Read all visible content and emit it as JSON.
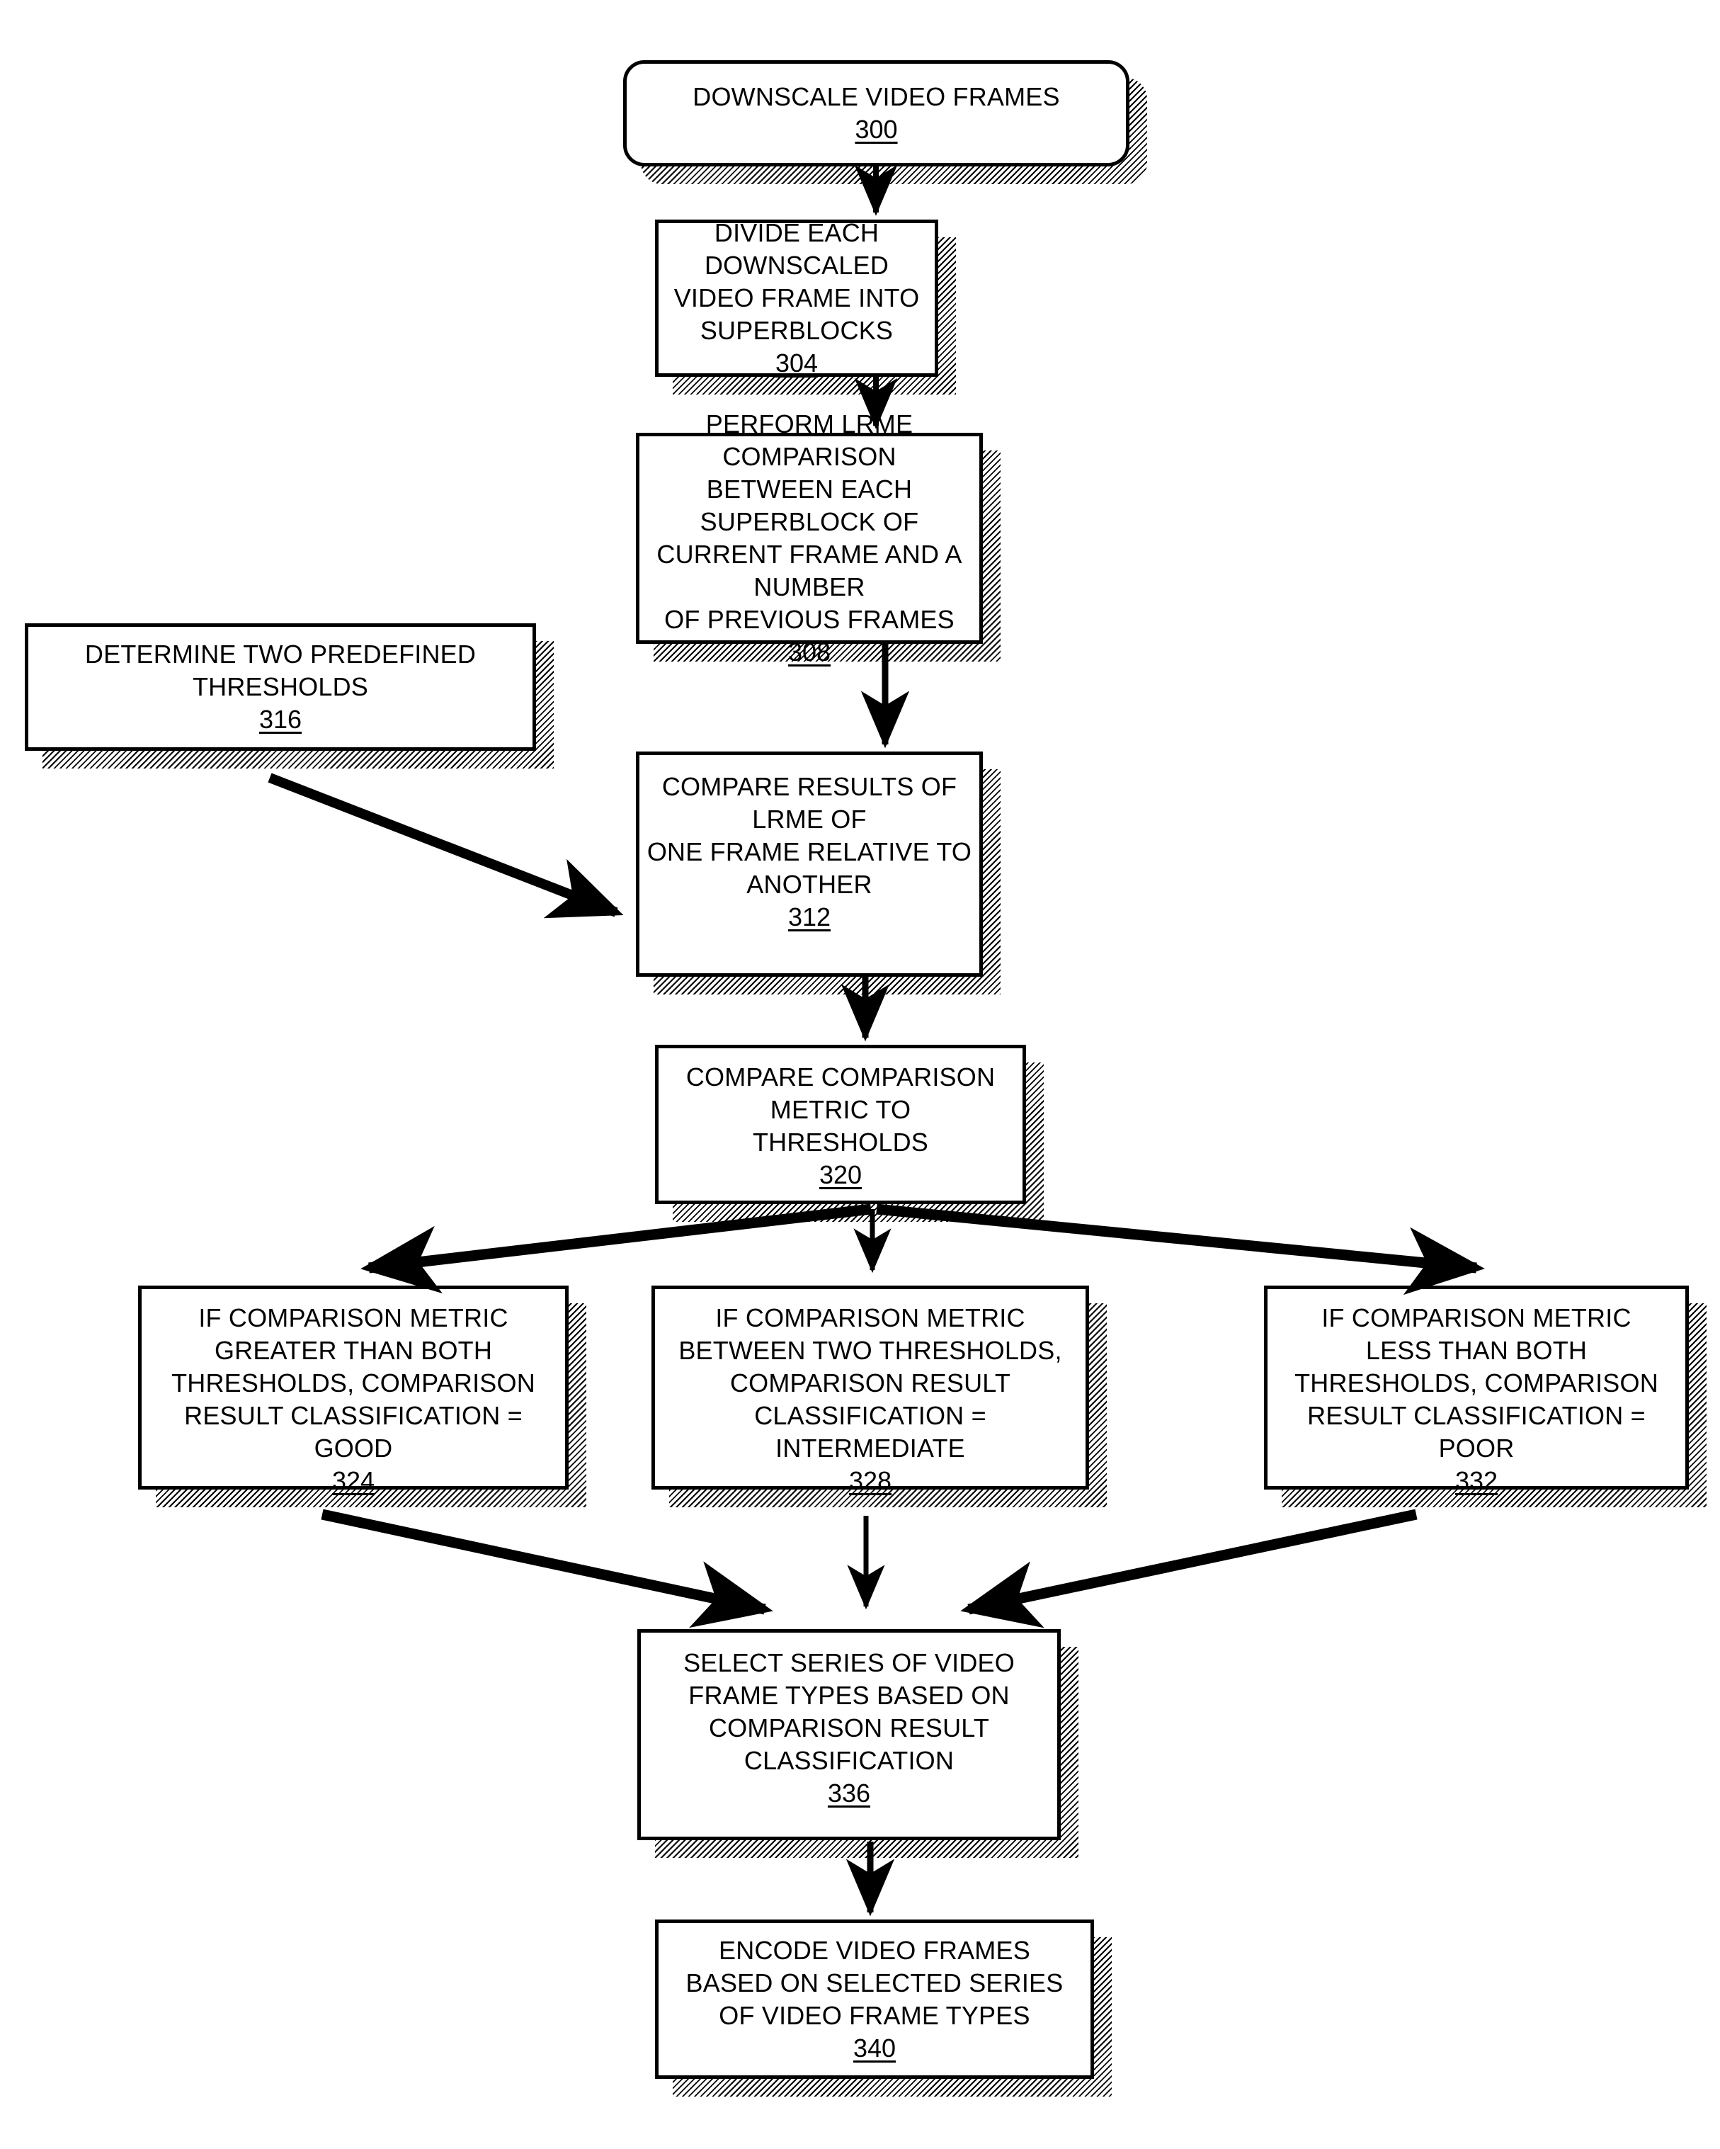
{
  "figure": {
    "type": "process-flowchart",
    "background_color": "#ffffff",
    "line_color": "#000000",
    "shadow_style": "diagonal-hatch"
  },
  "nodes": [
    {
      "id": "n300",
      "ref": "300",
      "text": "DOWNSCALE VIDEO FRAMES",
      "shape": "rounded-rectangle"
    },
    {
      "id": "n304",
      "ref": "304",
      "text": "DIVIDE EACH DOWNSCALED\nVIDEO FRAME INTO\nSUPERBLOCKS",
      "shape": "rectangle"
    },
    {
      "id": "n308",
      "ref": "308",
      "text": "PERFORM LRME COMPARISON\nBETWEEN EACH SUPERBLOCK OF\nCURRENT FRAME AND A NUMBER\nOF PREVIOUS FRAMES",
      "shape": "rectangle"
    },
    {
      "id": "n316",
      "ref": "316",
      "text": "DETERMINE TWO PREDEFINED\nTHRESHOLDS",
      "shape": "rectangle"
    },
    {
      "id": "n312",
      "ref": "312",
      "text": "COMPARE RESULTS OF LRME OF\nONE FRAME RELATIVE TO ANOTHER",
      "shape": "rectangle"
    },
    {
      "id": "n320",
      "ref": "320",
      "text": "COMPARE COMPARISON\nMETRIC TO\nTHRESHOLDS",
      "shape": "rectangle"
    },
    {
      "id": "n324",
      "ref": "324",
      "text": "IF COMPARISON METRIC\nGREATER THAN BOTH\nTHRESHOLDS, COMPARISON\nRESULT CLASSIFICATION =\nGOOD",
      "shape": "rectangle"
    },
    {
      "id": "n328",
      "ref": "328",
      "text": "IF COMPARISON METRIC\nBETWEEN TWO THRESHOLDS,\nCOMPARISON RESULT\nCLASSIFICATION =\nINTERMEDIATE",
      "shape": "rectangle"
    },
    {
      "id": "n332",
      "ref": "332",
      "text": "IF COMPARISON METRIC\nLESS THAN BOTH\nTHRESHOLDS, COMPARISON\nRESULT CLASSIFICATION  =\nPOOR",
      "shape": "rectangle"
    },
    {
      "id": "n336",
      "ref": "336",
      "text": "SELECT SERIES OF VIDEO\nFRAME TYPES BASED ON\nCOMPARISON RESULT\nCLASSIFICATION",
      "shape": "rectangle"
    },
    {
      "id": "n340",
      "ref": "340",
      "text": "ENCODE VIDEO FRAMES\nBASED ON SELECTED SERIES\nOF VIDEO FRAME TYPES",
      "shape": "rectangle"
    }
  ],
  "edges": [
    {
      "id": "e300-304",
      "from": "300",
      "to": "304",
      "style": "straight-down-arrow"
    },
    {
      "id": "e304-308",
      "from": "304",
      "to": "308",
      "style": "straight-down-arrow"
    },
    {
      "id": "e308-312",
      "from": "308",
      "to": "312",
      "style": "straight-down-arrow"
    },
    {
      "id": "e316-312",
      "from": "316",
      "to": "312",
      "style": "diagonal-arrow"
    },
    {
      "id": "e312-320",
      "from": "312",
      "to": "320",
      "style": "straight-down-arrow"
    },
    {
      "id": "e320-324",
      "from": "320",
      "to": "324",
      "style": "diagonal-left-arrow"
    },
    {
      "id": "e320-328",
      "from": "320",
      "to": "328",
      "style": "straight-down-arrow"
    },
    {
      "id": "e320-332",
      "from": "320",
      "to": "332",
      "style": "diagonal-right-arrow"
    },
    {
      "id": "e324-336",
      "from": "324",
      "to": "336",
      "style": "diagonal-right-arrow"
    },
    {
      "id": "e328-336",
      "from": "328",
      "to": "336",
      "style": "straight-down-arrow"
    },
    {
      "id": "e332-336",
      "from": "332",
      "to": "336",
      "style": "diagonal-left-arrow"
    },
    {
      "id": "e336-340",
      "from": "336",
      "to": "340",
      "style": "straight-down-arrow"
    }
  ]
}
